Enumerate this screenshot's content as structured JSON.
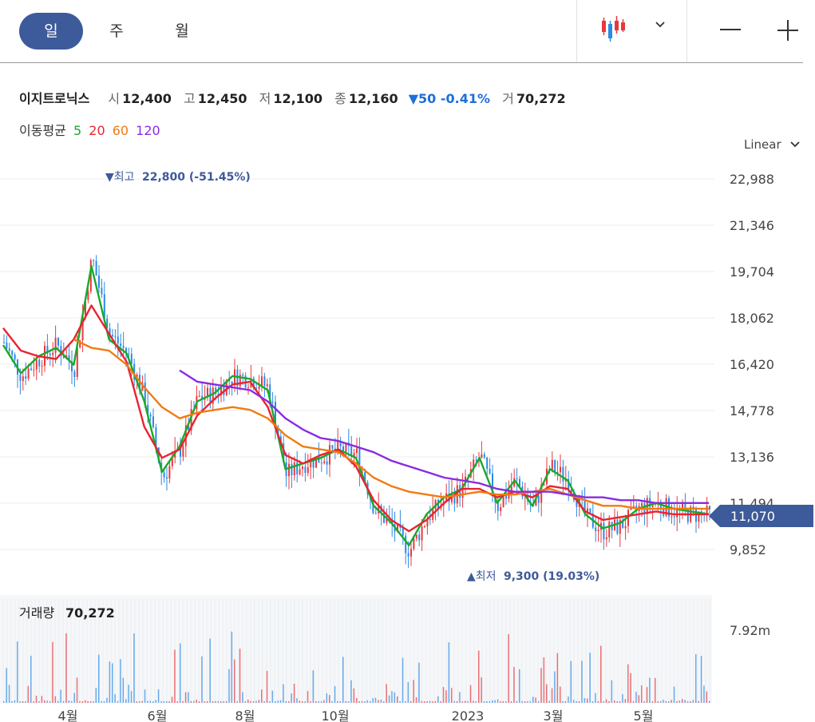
{
  "tabs": [
    {
      "label": "일",
      "active": true
    },
    {
      "label": "주",
      "active": false
    },
    {
      "label": "월",
      "active": false
    }
  ],
  "toolbar": {
    "chart_type_icon": "candlestick-icon",
    "dropdown_icon": "chevron-down-icon",
    "zoom_out_icon": "minus-icon",
    "zoom_in_icon": "plus-icon"
  },
  "quote": {
    "name": "이지트로닉스",
    "open_label": "시",
    "open": "12,400",
    "high_label": "고",
    "high": "12,450",
    "low_label": "저",
    "low": "12,100",
    "close_label": "종",
    "close": "12,160",
    "change": "▼50 -0.41%",
    "volume_label": "거",
    "volume": "70,272"
  },
  "ma_legend": {
    "label": "이동평균",
    "p5": "5",
    "p20": "20",
    "p60": "60",
    "p120": "120"
  },
  "scale_mode": "Linear",
  "colors": {
    "up": "#e8383d",
    "down": "#2b8ae6",
    "ma5": "#1aa82b",
    "ma20": "#e8242f",
    "ma60": "#f07b12",
    "ma120": "#8a2be2",
    "accent": "#3d5a9a"
  },
  "chart_data": {
    "type": "candlestick",
    "price_axis": {
      "ticks": [
        "22,988",
        "21,346",
        "19,704",
        "18,062",
        "16,420",
        "14,778",
        "13,136",
        "11,494",
        "9,852"
      ],
      "ylim": [
        9400,
        23300
      ]
    },
    "time_axis": {
      "ticks": [
        "4월",
        "6월",
        "8월",
        "10월",
        "2023",
        "3월",
        "5월"
      ]
    },
    "current_price": "11,070",
    "high_marker": {
      "text": "▼최고",
      "value": "22,800 (-51.45%)",
      "price": 22800
    },
    "low_marker": {
      "text": "▲최저",
      "value": "9,300 (19.03%)",
      "price": 9300
    },
    "volume_panel": {
      "label": "거래량",
      "value": "70,272",
      "axis_tick": "7.92m"
    },
    "x_positions": [
      0,
      1,
      2,
      3,
      4,
      5,
      6,
      7,
      8,
      9,
      10,
      11,
      12,
      13,
      14,
      15,
      16,
      17,
      18,
      19,
      20,
      21,
      22,
      23,
      24,
      25,
      26,
      27,
      28,
      29,
      30,
      31,
      32,
      33,
      34,
      35,
      36,
      37,
      38,
      39,
      40
    ],
    "close_path": [
      17200,
      16000,
      16600,
      17100,
      16300,
      20200,
      17500,
      16800,
      15200,
      12400,
      13400,
      15200,
      15400,
      16000,
      15900,
      15600,
      12500,
      12900,
      13100,
      13400,
      13200,
      11300,
      10700,
      9800,
      11000,
      11600,
      12000,
      13200,
      11400,
      12300,
      11300,
      12800,
      12300,
      11000,
      10500,
      10700,
      11300,
      11500,
      11200,
      11100,
      11070
    ],
    "series": [
      {
        "name": "5",
        "values": [
          17100,
          16100,
          16700,
          17000,
          16400,
          19900,
          17300,
          16800,
          15100,
          12600,
          13500,
          15100,
          15400,
          16000,
          15900,
          15500,
          12700,
          12900,
          13100,
          13400,
          13100,
          11400,
          10800,
          10000,
          11100,
          11700,
          12000,
          13100,
          11500,
          12300,
          11400,
          12700,
          12300,
          11100,
          10600,
          10800,
          11300,
          11500,
          11300,
          11200,
          11100
        ]
      },
      {
        "name": "20",
        "values": [
          17700,
          16900,
          16700,
          16600,
          17300,
          18500,
          17500,
          16500,
          14200,
          13100,
          13400,
          14600,
          15200,
          15700,
          15800,
          14900,
          13200,
          12900,
          13200,
          13400,
          12800,
          11600,
          10900,
          10500,
          10900,
          11500,
          12000,
          12000,
          11700,
          11900,
          11700,
          12100,
          12000,
          11200,
          10900,
          11000,
          11100,
          11200,
          11100,
          11100,
          11100
        ]
      },
      {
        "name": "60",
        "values": [
          null,
          null,
          null,
          null,
          17300,
          17000,
          16900,
          16400,
          15600,
          14900,
          14500,
          14700,
          14800,
          14900,
          14800,
          14500,
          13900,
          13500,
          13400,
          13300,
          12900,
          12400,
          12100,
          11900,
          11800,
          11700,
          11800,
          11900,
          11800,
          11800,
          11900,
          12000,
          11800,
          11600,
          11400,
          11400,
          11300,
          11300,
          11300,
          11300,
          11300
        ]
      },
      {
        "name": "120",
        "values": [
          null,
          null,
          null,
          null,
          null,
          null,
          null,
          null,
          null,
          null,
          16200,
          15800,
          15700,
          15600,
          15500,
          15100,
          14500,
          14100,
          13800,
          13700,
          13500,
          13300,
          13000,
          12800,
          12600,
          12400,
          12300,
          12200,
          12000,
          11900,
          11900,
          11900,
          11800,
          11700,
          11700,
          11600,
          11600,
          11500,
          11500,
          11500,
          11500
        ]
      }
    ]
  }
}
